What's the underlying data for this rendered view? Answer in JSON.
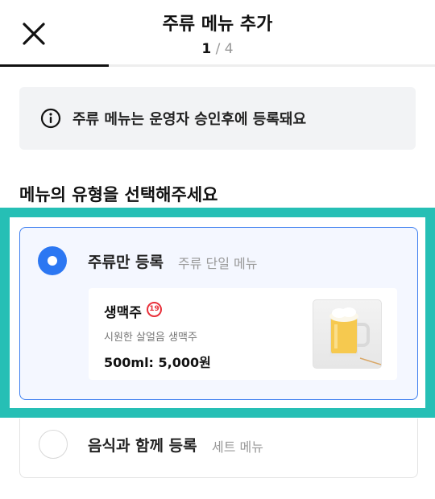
{
  "header": {
    "title": "주류 메뉴 추가",
    "step_current": "1",
    "step_separator": " / ",
    "step_total": "4",
    "progress": 0.25,
    "close_icon": "close-icon"
  },
  "notice": {
    "icon": "info-icon",
    "text": "주류 메뉴는 운영자 승인후에 등록돼요"
  },
  "section": {
    "title": "메뉴의 유형을 선택해주세요"
  },
  "options": [
    {
      "label": "주류만 등록",
      "sub": "주류 단일 메뉴",
      "selected": true,
      "example": {
        "name": "생맥주",
        "age_badge": "19",
        "description": "시원한 살얼음 생맥주",
        "price": "500ml: 5,000원",
        "image": "beer-mug-image"
      }
    },
    {
      "label": "음식과 함께 등록",
      "sub": "세트 메뉴",
      "selected": false
    }
  ],
  "colors": {
    "accent_blue": "#2c77f2",
    "highlight_teal": "#26bfb5",
    "age_badge_red": "#e8303a"
  }
}
